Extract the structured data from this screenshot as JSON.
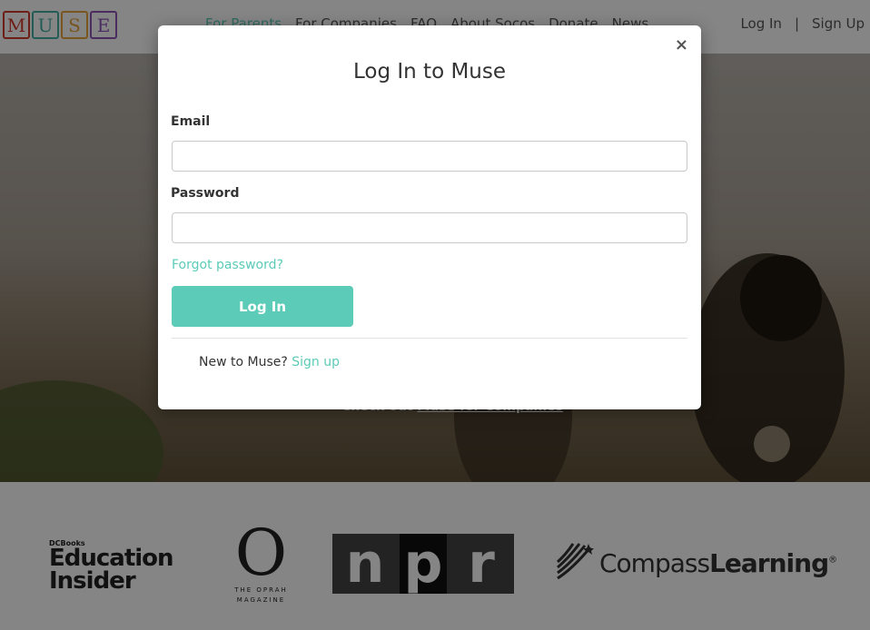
{
  "header": {
    "logo_letters": [
      {
        "char": "M",
        "color": "#d33b2c"
      },
      {
        "char": "U",
        "color": "#43b0a4"
      },
      {
        "char": "S",
        "color": "#e8a33d"
      },
      {
        "char": "E",
        "color": "#8e55b8"
      }
    ],
    "nav": [
      "For Parents",
      "For Companies",
      "FAQ",
      "About Socos",
      "Donate",
      "News"
    ],
    "auth": {
      "login": "Log In",
      "separator": "|",
      "signup": "Sign Up"
    }
  },
  "hero": {
    "cta_prefix": "Check out",
    "cta_link": "Muse for Companies"
  },
  "press": {
    "education_insider": {
      "top": "DCBooks",
      "line1": "Education",
      "line2": "Insider"
    },
    "oprah": {
      "letter": "O",
      "line1": "THE OPRAH",
      "line2": "MAGAZINE"
    },
    "npr": [
      "n",
      "p",
      "r"
    ],
    "compass": {
      "light": "Compass",
      "bold": "Learning",
      "mark": "®"
    }
  },
  "modal": {
    "close": "×",
    "title": "Log In to Muse",
    "email_label": "Email",
    "email_value": "",
    "password_label": "Password",
    "password_value": "",
    "forgot": "Forgot password?",
    "login_button": "Log In",
    "new_prefix": "New to Muse?",
    "signup_link": "Sign up"
  },
  "colors": {
    "accent": "#5ccbb7",
    "text": "#333333"
  }
}
